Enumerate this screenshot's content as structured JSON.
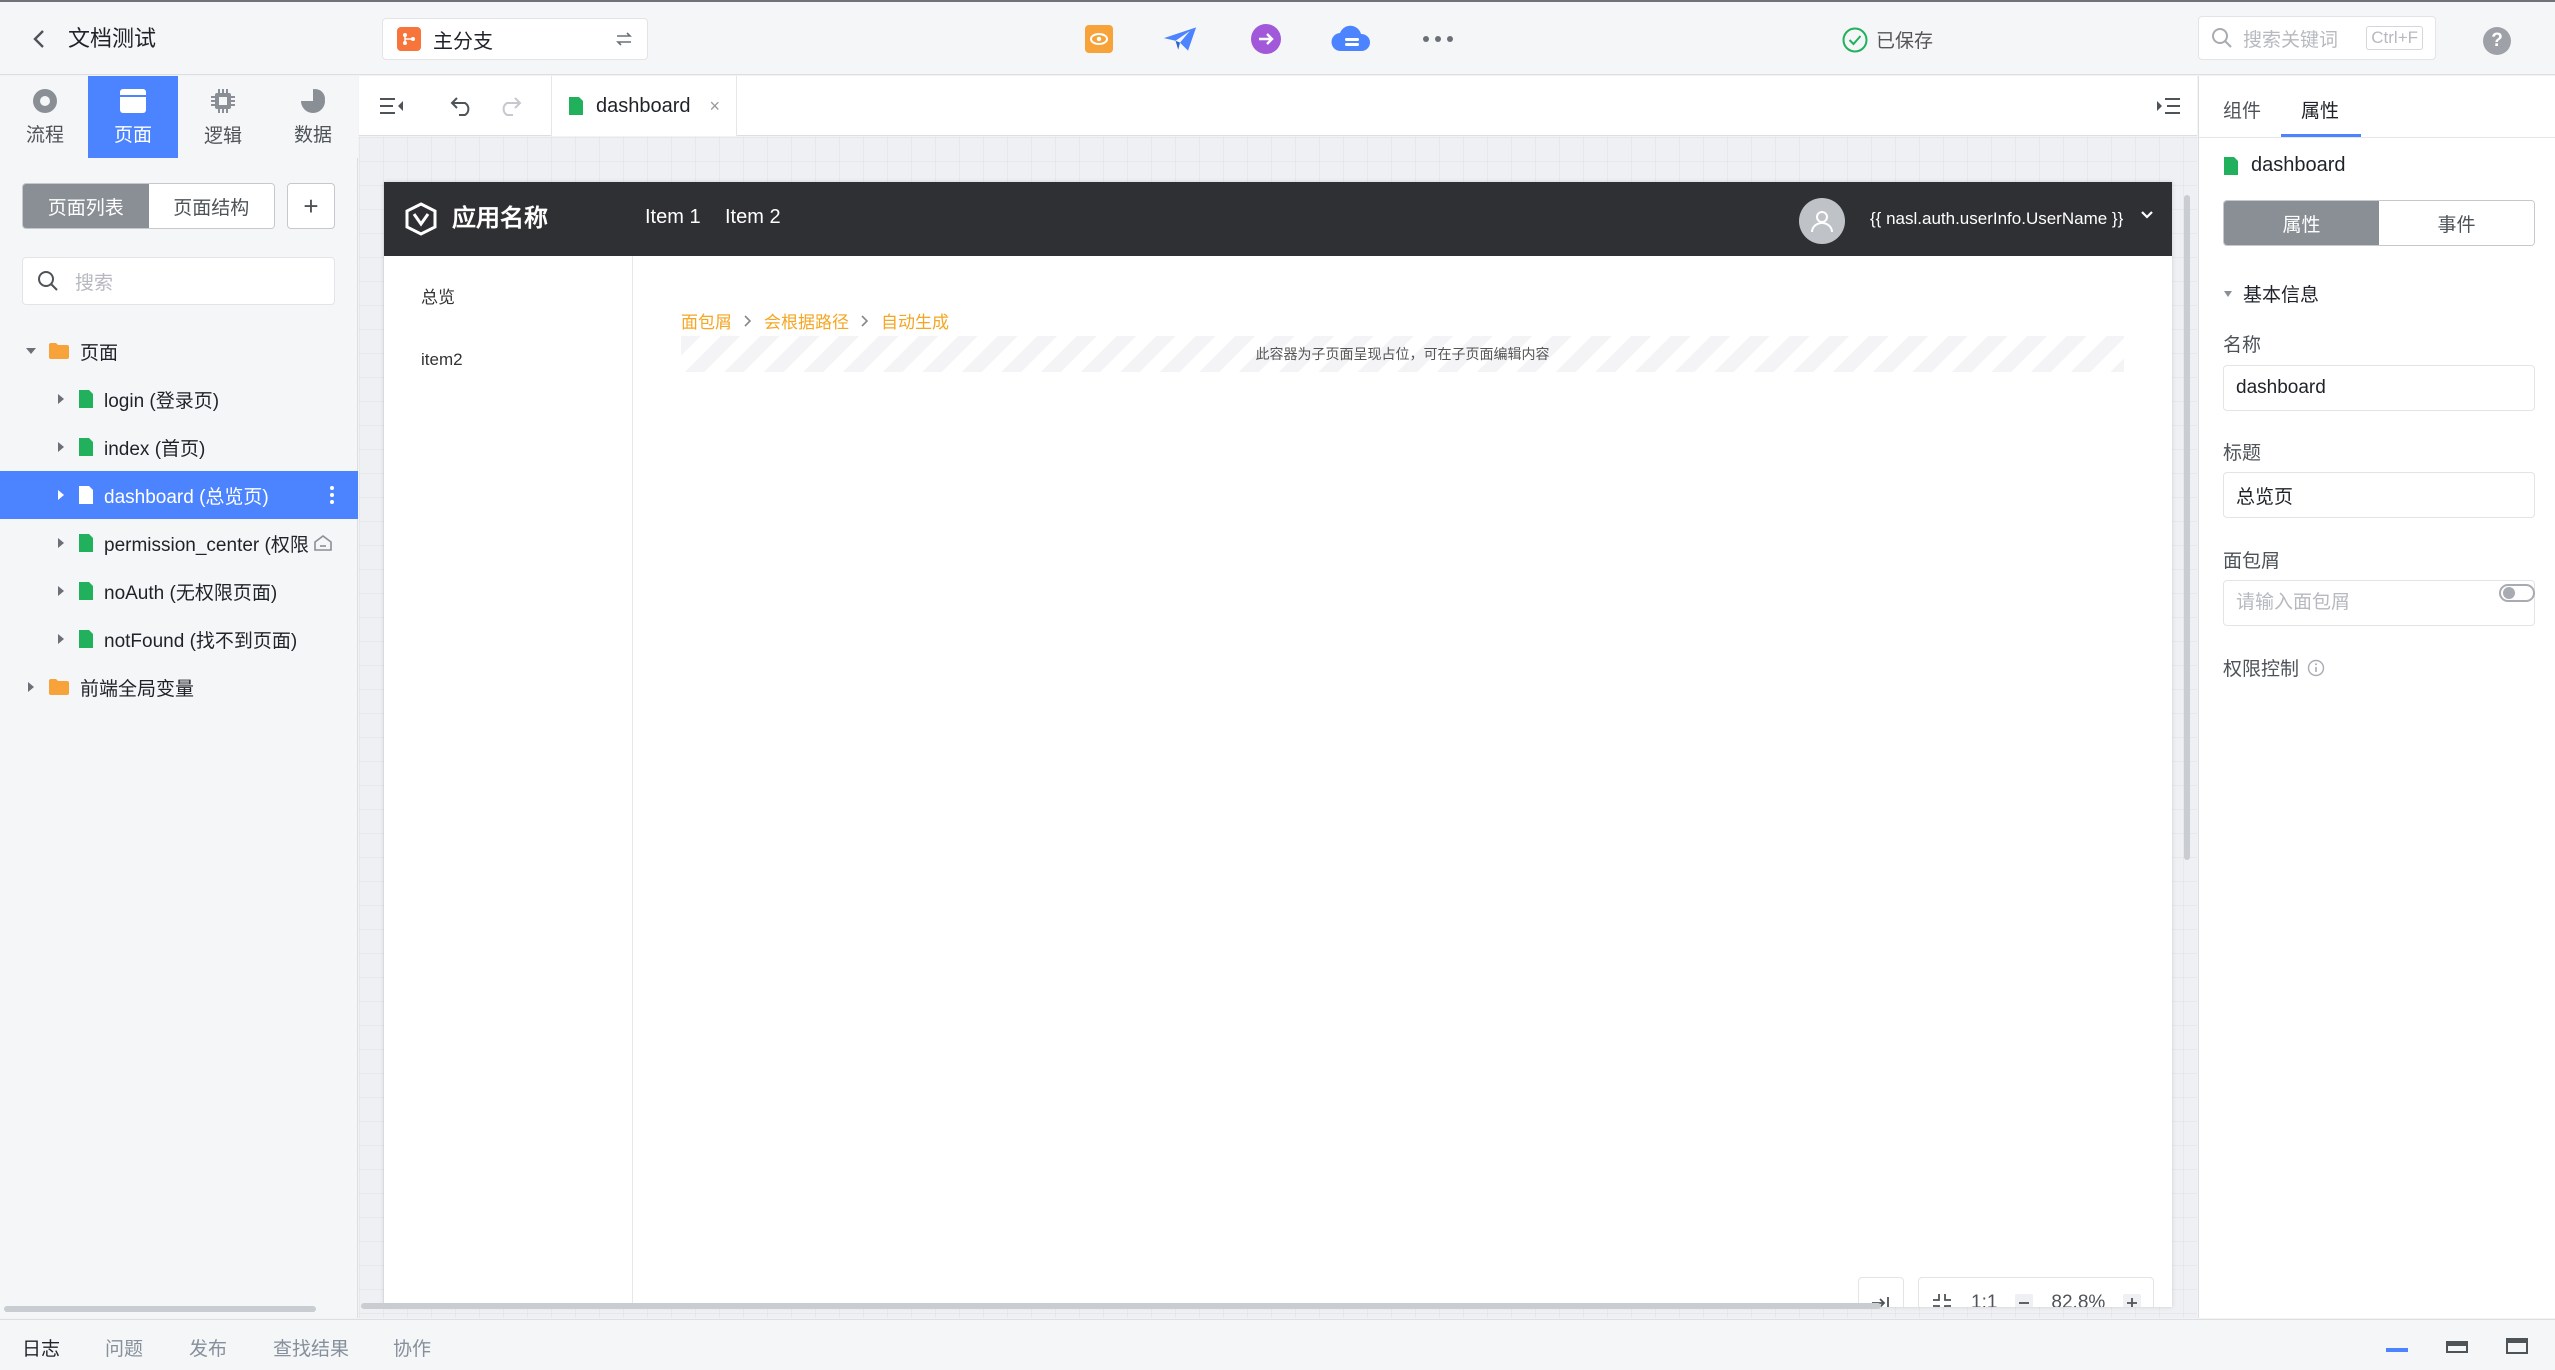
{
  "header": {
    "app_title": "文档测试",
    "branch": {
      "label": "主分支"
    },
    "saved_status": "已保存",
    "search": {
      "placeholder": "搜索关键词",
      "shortcut": "Ctrl+F"
    },
    "help_label": "?",
    "tools": [
      {
        "icon": "preview-icon",
        "color": "#f7a33a"
      },
      {
        "icon": "publish-plane-icon",
        "color": "#4c84ff"
      },
      {
        "icon": "arrow-circle-icon",
        "color": "#a259d9"
      },
      {
        "icon": "cloud-icon",
        "color": "#4c84ff"
      },
      {
        "icon": "more-icon",
        "color": "#6b7077"
      }
    ]
  },
  "left_nav": {
    "tabs": [
      {
        "label": "流程",
        "icon": "process-icon"
      },
      {
        "label": "页面",
        "icon": "page-icon",
        "active": true
      },
      {
        "label": "逻辑",
        "icon": "logic-chip-icon"
      },
      {
        "label": "数据",
        "icon": "data-pie-icon"
      }
    ]
  },
  "left_panel": {
    "segmented": {
      "list_label": "页面列表",
      "structure_label": "页面结构"
    },
    "add_label": "+",
    "search_placeholder": "搜索",
    "tree": {
      "root_label": "页面",
      "pages": [
        {
          "label": "login (登录页)"
        },
        {
          "label": "index (首页)"
        },
        {
          "label": "dashboard (总览页)",
          "selected": true
        },
        {
          "label": "permission_center (权限"
        },
        {
          "label": "noAuth (无权限页面)"
        },
        {
          "label": "notFound (找不到页面)"
        }
      ],
      "globals_label": "前端全局变量"
    }
  },
  "editor": {
    "tab_label": "dashboard",
    "tab_close": "×",
    "preview": {
      "app_name": "应用名称",
      "nav_items": [
        "Item 1",
        "Item 2"
      ],
      "user_expr": "{{ nasl.auth.userInfo.UserName }}",
      "side_items": [
        "总览",
        "item2"
      ],
      "breadcrumb": [
        "面包屑",
        "会根据路径",
        "自动生成"
      ],
      "placeholder_text": "此容器为子页面呈现占位，可在子页面编辑内容"
    },
    "zoom": {
      "ratio_label": "1:1",
      "value": "82.8%"
    }
  },
  "right_panel": {
    "tabs": [
      {
        "label": "组件"
      },
      {
        "label": "属性",
        "active": true
      }
    ],
    "page_name": "dashboard",
    "segmented": {
      "props_label": "属性",
      "events_label": "事件"
    },
    "section_title": "基本信息",
    "fields": {
      "name": {
        "label": "名称",
        "value": "dashboard"
      },
      "title": {
        "label": "标题",
        "value": "总览页"
      },
      "breadcrumb": {
        "label": "面包屑",
        "placeholder": "请输入面包屑"
      },
      "permission": {
        "label": "权限控制",
        "enabled": false
      }
    }
  },
  "bottom_bar": {
    "tabs": [
      {
        "label": "日志",
        "active": true
      },
      {
        "label": "问题"
      },
      {
        "label": "发布"
      },
      {
        "label": "查找结果"
      },
      {
        "label": "协作"
      }
    ]
  },
  "colors": {
    "accent": "#4c84ff",
    "page_file": "#21b15d",
    "folder": "#f7a33a",
    "breadcrumb": "#f5a623",
    "preview_header": "#2f3033"
  }
}
